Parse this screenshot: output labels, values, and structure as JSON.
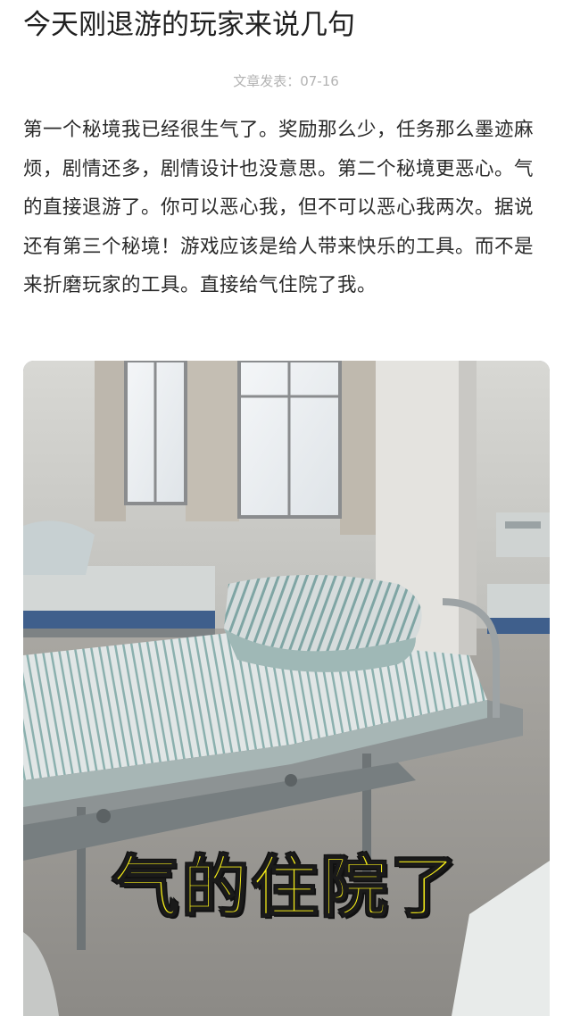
{
  "article": {
    "title": "今天刚退游的玩家来说几句",
    "meta": "文章发表：07-16",
    "body": "第一个秘境我已经很生气了。奖励那么少，任务那么墨迹麻烦，剧情还多，剧情设计也没意思。第二个秘境更恶心。气的直接退游了。你可以恶心我，但不可以恶心我两次。据说还有第三个秘境！游戏应该是给人带来快乐的工具。而不是来折磨玩家的工具。直接给气住院了我。"
  },
  "photo": {
    "caption": "气的住院了",
    "caption_color": "#f7ee18"
  }
}
